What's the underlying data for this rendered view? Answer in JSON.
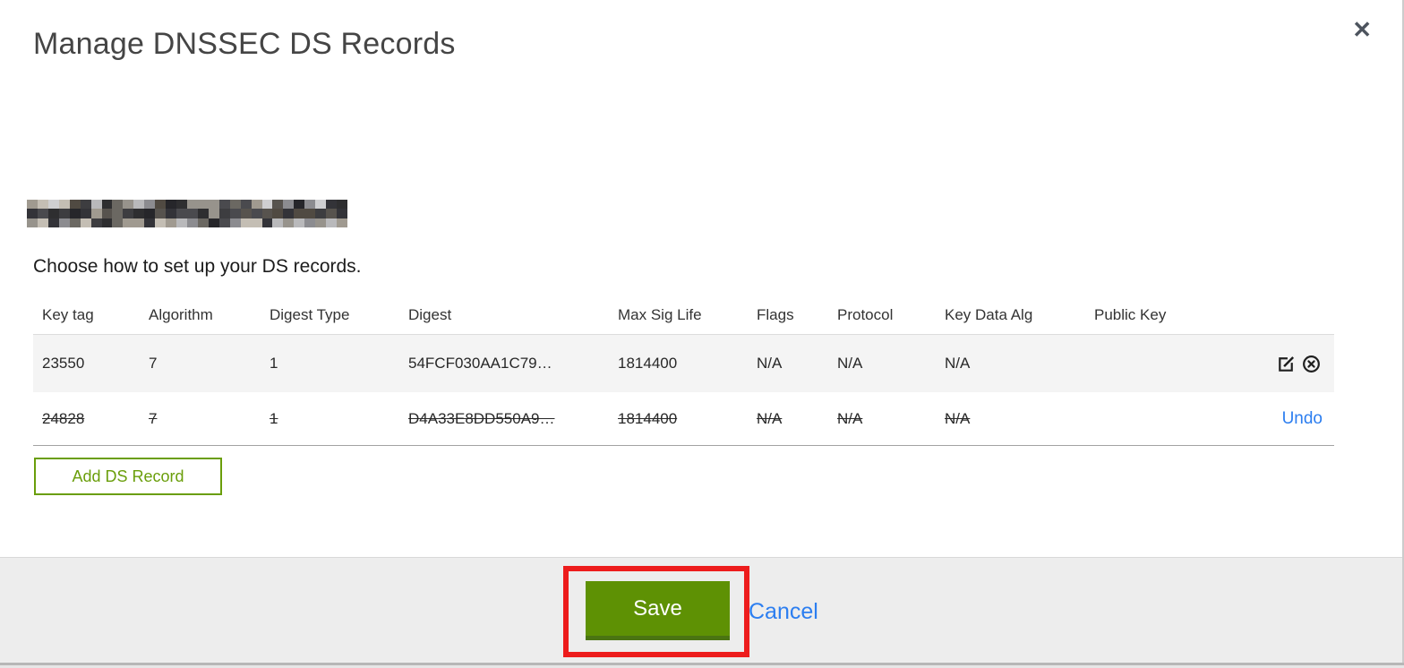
{
  "modal": {
    "title": "Manage DNSSEC DS Records",
    "close_glyph": "✕",
    "subtitle": "Choose how to set up your DS records."
  },
  "redacted_domain": {
    "note": "domain name is pixelated/redacted in screenshot",
    "cols": 30,
    "rows": 3,
    "seed": 7,
    "palette_dark": [
      "#2e2e30",
      "#3d3d40",
      "#4a4a4e",
      "#57534e",
      "#333338",
      "#6b6862",
      "#26262a",
      "#504a42"
    ],
    "palette_light": [
      "#b9b9bb",
      "#a09a90",
      "#8c8c90",
      "#cfcfd1",
      "#97938c",
      "#c4beb4"
    ]
  },
  "table": {
    "columns": [
      "Key tag",
      "Algorithm",
      "Digest Type",
      "Digest",
      "Max Sig Life",
      "Flags",
      "Protocol",
      "Key Data Alg",
      "Public Key"
    ],
    "rows": [
      {
        "key_tag": "23550",
        "algorithm": "7",
        "digest_type": "1",
        "digest": "54FCF030AA1C79…",
        "max_sig_life": "1814400",
        "flags": "N/A",
        "protocol": "N/A",
        "key_data_alg": "N/A",
        "public_key": "",
        "state": "active"
      },
      {
        "key_tag": "24828",
        "algorithm": "7",
        "digest_type": "1",
        "digest": "D4A33E8DD550A9…",
        "max_sig_life": "1814400",
        "flags": "N/A",
        "protocol": "N/A",
        "key_data_alg": "N/A",
        "public_key": "",
        "state": "marked-for-deletion",
        "undo_label": "Undo"
      }
    ]
  },
  "buttons": {
    "add_ds_record": "Add DS Record",
    "save": "Save",
    "cancel": "Cancel"
  },
  "colors": {
    "save_green": "#5e9104",
    "outline_green": "#6a9e0b",
    "link_blue": "#2c7ef0",
    "annotation_red": "#ed1c1c",
    "row_stripe": "#f4f4f4"
  },
  "annotation": {
    "type": "red-rectangle-highlight",
    "target": "save-button"
  }
}
